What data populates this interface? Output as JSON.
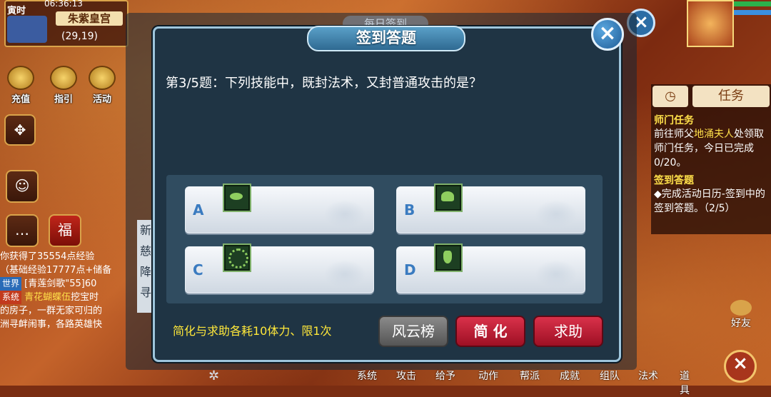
{
  "hud": {
    "time_tag": "寅时",
    "clock": "06:36:13",
    "place": "朱紫皇宫",
    "coords": "(29,19)",
    "buttons": [
      {
        "label": "充值",
        "icon": "recharge-icon"
      },
      {
        "label": "指引",
        "icon": "guide-icon"
      },
      {
        "label": "活动",
        "icon": "activity-icon"
      }
    ],
    "background_title": "每日签到"
  },
  "chat": {
    "lines": [
      {
        "text": "你获得了35554点经验"
      },
      {
        "text": "（基础经验17777点+储备"
      },
      {
        "tag": "世界",
        "text": "[青莲剑歌\"55]60"
      },
      {
        "tag": "系统",
        "name": "青花蝴蝶伍",
        "text": "挖宝时"
      },
      {
        "text": "的房子，一群无家可归的"
      },
      {
        "text": "洲寻衅闹事，各路英雄快"
      }
    ],
    "side_fragment": [
      "新",
      "慈",
      "降",
      "寻"
    ]
  },
  "task": {
    "tabs": [
      "任务"
    ],
    "tab_icon": "clock-icon",
    "sections": [
      {
        "title": "师门任务",
        "text_pre": "前往师父",
        "npc": "地涌夫人",
        "text_post": "处领取师门任务，今日已完成0/20。"
      },
      {
        "title": "签到答题",
        "text": "◆完成活动日历-签到中的签到答题。（2/5）"
      }
    ],
    "friend_label": "好友"
  },
  "bottom_menu": [
    "系统",
    "攻击",
    "给予",
    "动作",
    "帮派",
    "成就",
    "组队",
    "法术",
    "道具"
  ],
  "dialog": {
    "title": "签到答题",
    "question": "第3/5题：下列技能中，既封法术，又封普通攻击的是？",
    "options": [
      {
        "letter": "A",
        "icon": "lips-skill-icon"
      },
      {
        "letter": "B",
        "icon": "flower-skill-icon"
      },
      {
        "letter": "C",
        "icon": "seal-skill-icon"
      },
      {
        "letter": "D",
        "icon": "vase-skill-icon"
      }
    ],
    "notice": "简化与求助各耗10体力、限1次",
    "buttons": {
      "rank": "风云榜",
      "simplify": "简 化",
      "help": "求助"
    }
  },
  "colors": {
    "notice": "#ffe83a",
    "accent_red": "#c8233c",
    "dialog_bg": "#1f3444"
  }
}
